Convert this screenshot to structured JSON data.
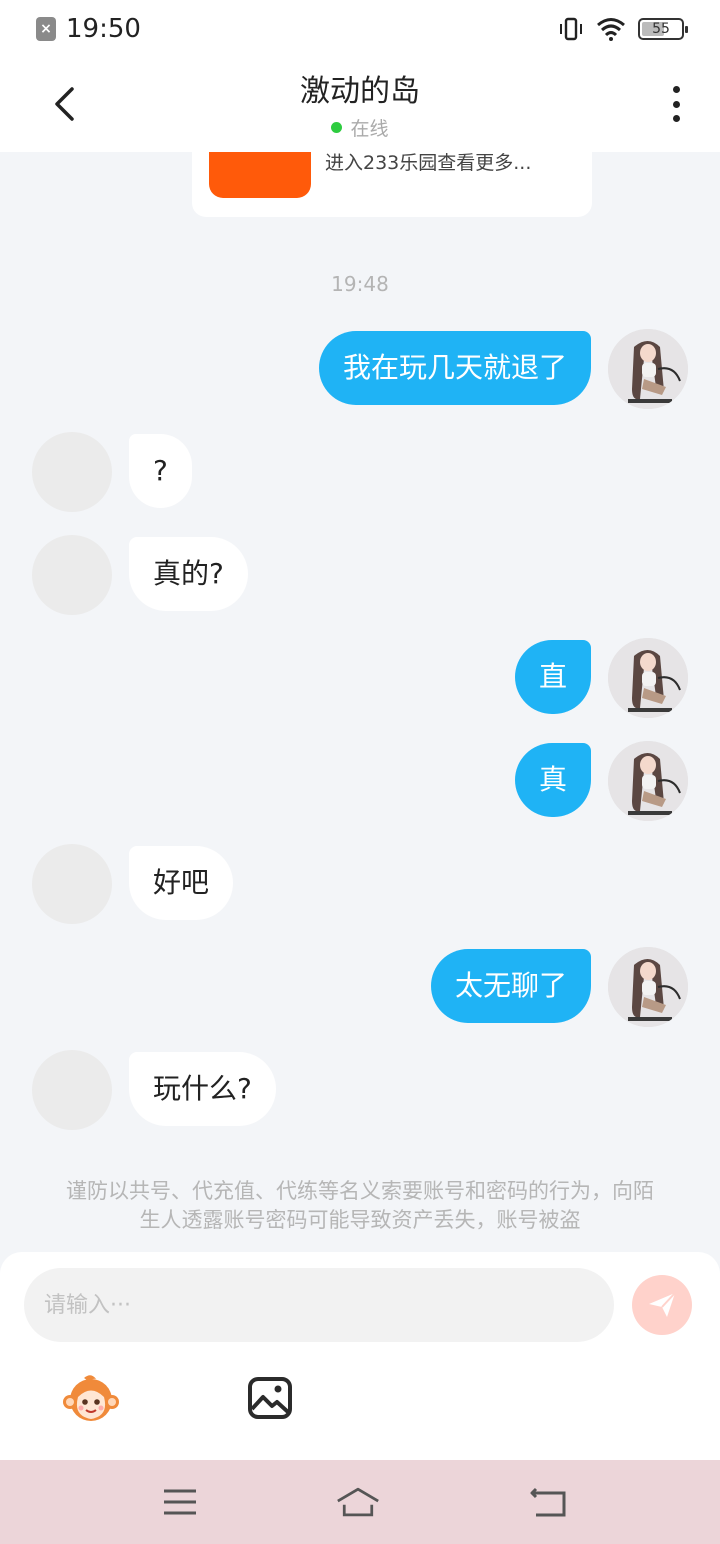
{
  "status_bar": {
    "time": "19:50",
    "battery": "55",
    "battery_level": 0.55,
    "icons": [
      "sim-off-icon",
      "vibrate-icon",
      "wifi-icon",
      "battery-icon"
    ]
  },
  "header": {
    "title": "激动的岛",
    "status": "在线",
    "back_icon": "back-chevron-icon",
    "more_icon": "more-vertical-icon"
  },
  "promo_card": {
    "text": "进入233乐园查看更多..."
  },
  "timestamp": "19:48",
  "messages": [
    {
      "sender": "me",
      "text": "我在玩几天就退了"
    },
    {
      "sender": "other",
      "text": "?"
    },
    {
      "sender": "other",
      "text": "真的?"
    },
    {
      "sender": "me",
      "text": "直"
    },
    {
      "sender": "me",
      "text": "真"
    },
    {
      "sender": "other",
      "text": "好吧"
    },
    {
      "sender": "me",
      "text": "太无聊了"
    },
    {
      "sender": "other",
      "text": "玩什么?"
    }
  ],
  "warning": "谨防以共号、代充值、代练等名义索要账号和密码的行为，向陌生人透露账号密码可能导致资产丢失，账号被盗",
  "input": {
    "placeholder": "请输入···",
    "send_icon": "send-plane-icon",
    "emoji_icon": "emoji-monkey-icon",
    "image_icon": "image-icon"
  },
  "nav_bar": {
    "icons": [
      "menu-icon",
      "home-icon",
      "back-icon"
    ]
  },
  "colors": {
    "my_bubble": "#1fb3f5",
    "other_bubble": "#ffffff",
    "background": "#f3f5f8",
    "online_dot": "#2ecc40",
    "send_button": "#ffd2cb",
    "nav_bar": "#ecd5d9"
  }
}
